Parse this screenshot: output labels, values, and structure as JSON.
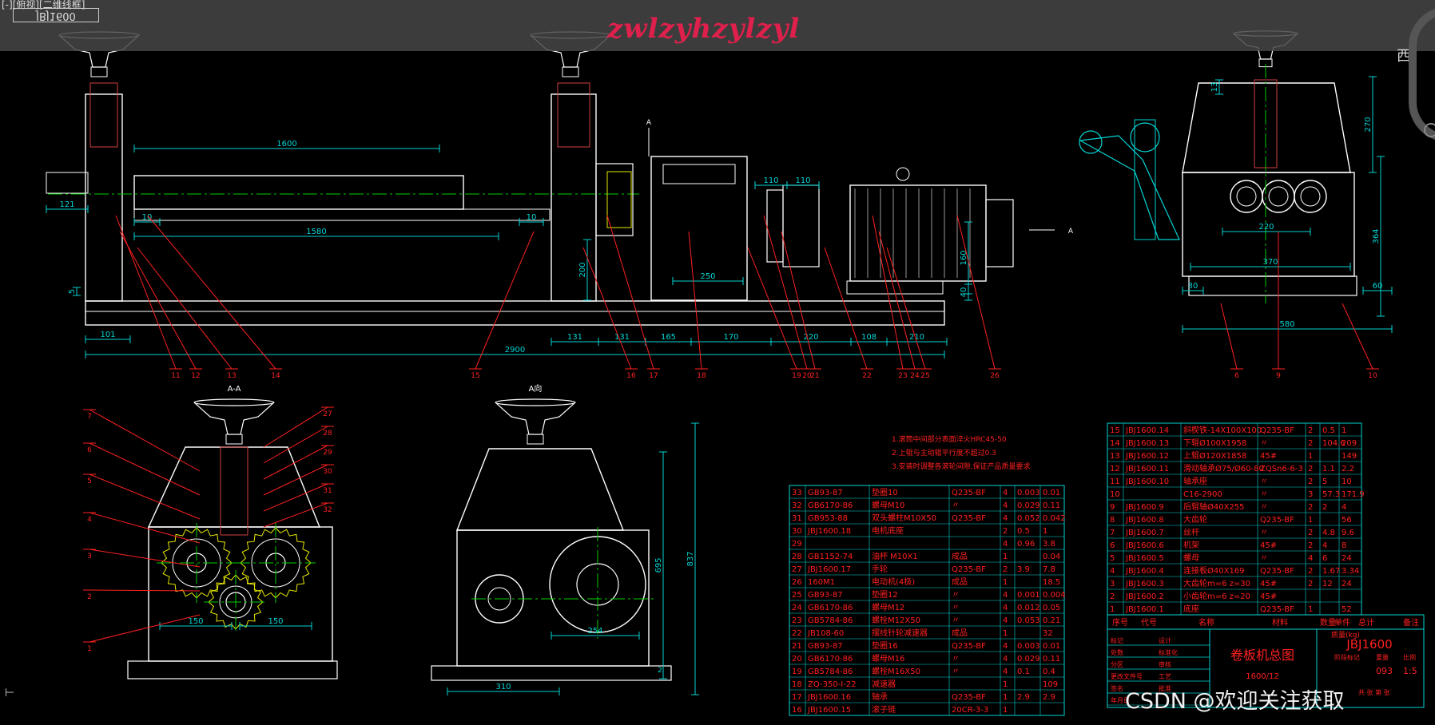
{
  "app": {
    "top_label": "[-][俯视][二维线框]",
    "drawing_code_box": "JBJ1600",
    "watermark": "zwlzyhzylzyl",
    "compass_label": "西",
    "credit": "CSDN @欢迎关注获取"
  },
  "colors": {
    "background": "#000000",
    "outline": "#ffffff",
    "centerline": "#00cc00",
    "dimension": "#00d5d5",
    "section": "#d04040",
    "hidden": "#e8e800",
    "leader": "#ff2020",
    "watermark": "#e0204c"
  },
  "front_view": {
    "dimensions": [
      "1600",
      "1580",
      "121",
      "5",
      "10",
      "10",
      "101",
      "2900",
      "131",
      "131",
      "165",
      "170",
      "220",
      "108",
      "210",
      "250",
      "200",
      "110",
      "110",
      "160",
      "40",
      "A",
      "A"
    ],
    "leaders": [
      "11",
      "12",
      "13",
      "14",
      "15",
      "16",
      "17",
      "18",
      "19",
      "20",
      "21",
      "22",
      "23",
      "24",
      "25",
      "26"
    ]
  },
  "side_view": {
    "dimensions": [
      "270",
      "220",
      "370",
      "580",
      "30",
      "60",
      "364",
      "13"
    ],
    "leaders": [
      "6",
      "9",
      "10"
    ]
  },
  "section_aa": {
    "title": "A-A",
    "dimensions": [
      "150",
      "150"
    ],
    "leaders": [
      "7",
      "6",
      "5",
      "4",
      "3",
      "2",
      "1",
      "27",
      "28",
      "29",
      "30",
      "31",
      "32"
    ]
  },
  "view_a": {
    "title": "A向",
    "dimensions": [
      "695",
      "837",
      "254",
      "310",
      "2"
    ]
  },
  "notes": [
    "1.滚筒中间部分表面淬火HRC45-50",
    "2.上辊与主动辊平行度不超过0.3",
    "3.安装时调整各滚轮间隙,保证产品质量要求"
  ],
  "bom_left": {
    "rows": [
      [
        "33",
        "GB93-87",
        "垫圈10",
        "Q235-BF",
        "4",
        "0.003",
        "0.01"
      ],
      [
        "32",
        "GB6170-86",
        "螺母M10",
        "〃",
        "4",
        "0.029",
        "0.11"
      ],
      [
        "31",
        "GB953-88",
        "双头螺柱M10X50",
        "Q235-BF",
        "4",
        "0.052",
        "0.042"
      ],
      [
        "30",
        "JBJ1600.18",
        "电机底座",
        "",
        "2",
        "0.5",
        "1"
      ],
      [
        "29",
        "",
        "",
        "",
        "4",
        "0.96",
        "3.8"
      ],
      [
        "28",
        "GB1152-74",
        "油杯 M10X1",
        "成品",
        "1",
        "",
        "0.04"
      ],
      [
        "27",
        "JBJ1600.17",
        "手轮",
        "Q235-BF",
        "2",
        "3.9",
        "7.8"
      ],
      [
        "26",
        "160M1",
        "电动机(4极)",
        "成品",
        "1",
        "",
        "18.5"
      ],
      [
        "25",
        "GB93-87",
        "垫圈12",
        "〃",
        "4",
        "0.001",
        "0.004"
      ],
      [
        "24",
        "GB6170-86",
        "螺母M12",
        "〃",
        "4",
        "0.012",
        "0.05"
      ],
      [
        "23",
        "GB5784-86",
        "螺栓M12X50",
        "〃",
        "4",
        "0.053",
        "0.21"
      ],
      [
        "22",
        "JB108-60",
        "摆线针轮减速器",
        "成品",
        "1",
        "",
        "32"
      ],
      [
        "21",
        "GB93-87",
        "垫圈16",
        "Q235-BF",
        "4",
        "0.003",
        "0.01"
      ],
      [
        "20",
        "GB6170-86",
        "螺母M16",
        "〃",
        "4",
        "0.029",
        "0.11"
      ],
      [
        "19",
        "GB5784-86",
        "螺栓M16X50",
        "〃",
        "4",
        "0.1",
        "0.4"
      ],
      [
        "18",
        "ZQ-350-I-22",
        "减速器",
        "",
        "1",
        "",
        "109"
      ],
      [
        "17",
        "JBJ1600.16",
        "轴承",
        "Q235-BF",
        "1",
        "2.9",
        "2.9"
      ],
      [
        "16",
        "JBJ1600.15",
        "滚子链",
        "20CR-3-3",
        "1",
        "",
        ""
      ]
    ]
  },
  "bom_right": {
    "rows": [
      [
        "15",
        "JBJ1600.14",
        "斜楔铁-14X100X100",
        "Q235-BF",
        "2",
        "0.5",
        "1"
      ],
      [
        "14",
        "JBJ1600.13",
        "下辊Ø100X1958",
        "〃",
        "2",
        "104.6",
        "209"
      ],
      [
        "13",
        "JBJ1600.12",
        "上辊Ø120X1858",
        "45#",
        "1",
        "",
        "149"
      ],
      [
        "12",
        "JBJ1600.11",
        "滑动轴承Ø75/Ø60-80",
        "ZQSn6-6-3",
        "2",
        "1.1",
        "2.2"
      ],
      [
        "11",
        "JBJ1600.10",
        "轴承座",
        "〃",
        "2",
        "5",
        "10"
      ],
      [
        "10",
        "",
        "C16-2900",
        "〃",
        "3",
        "57.3",
        "171.9"
      ],
      [
        "9",
        "JBJ1600.9",
        "后辊轴Ø40X255",
        "〃",
        "2",
        "2",
        "4"
      ],
      [
        "8",
        "JBJ1600.8",
        "大齿轮",
        "Q235-BF",
        "1",
        "",
        "56"
      ],
      [
        "7",
        "JBJ1600.7",
        "丝杆",
        "〃",
        "2",
        "4.8",
        "9.6"
      ],
      [
        "6",
        "JBJ1600.6",
        "机架",
        "45#",
        "2",
        "4",
        "8"
      ],
      [
        "5",
        "JBJ1600.5",
        "螺母",
        "〃",
        "4",
        "6",
        "24"
      ],
      [
        "4",
        "JBJ1600.4",
        "连接板Ø40X169",
        "Q235-BF",
        "2",
        "1.67",
        "3.34"
      ],
      [
        "3",
        "JBJ1600.3",
        "大齿轮m=6 z=30",
        "45#",
        "2",
        "12",
        "24"
      ],
      [
        "2",
        "JBJ1600.2",
        "小齿轮m=6 z=20",
        "45#",
        "",
        "",
        ""
      ],
      [
        "1",
        "JBJ1600.1",
        "底座",
        "Q235-BF",
        "1",
        "",
        "52"
      ]
    ],
    "header": [
      "序号",
      "代号",
      "名称",
      "材料",
      "数量",
      "单件",
      "总计",
      "备注"
    ],
    "weight_unit": "质量(kg)"
  },
  "title_block": {
    "name": "卷板机总图",
    "sub": "1600/12",
    "code": "JBJ1600",
    "scale_label": "比例",
    "weight_label": "重量",
    "weight": "093",
    "scale": "1:5",
    "phase_label": "阶段标记",
    "sheets_label": "共 张  第 张",
    "rows": [
      "标记",
      "处数",
      "分区",
      "更改文件号",
      "签名",
      "年月日",
      "设计",
      "标准化",
      "审核",
      "工艺",
      "批准"
    ]
  }
}
